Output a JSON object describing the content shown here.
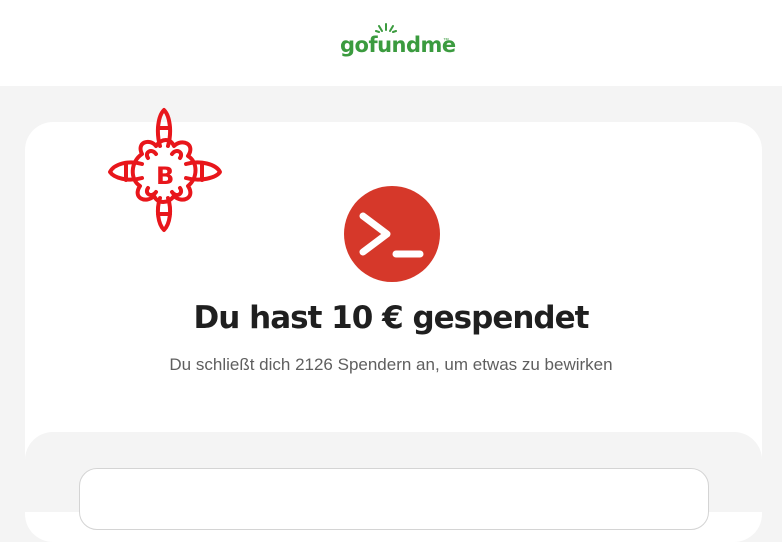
{
  "header": {
    "logo_text": "gofundme",
    "logo_mark": "™",
    "logo_color": "#3b9b3f"
  },
  "badge": {
    "icon": "bitcoin-b-scribble-icon",
    "letter": "B",
    "color": "#e8161b"
  },
  "confirmation": {
    "icon": "terminal-prompt-icon",
    "icon_color": "#d6382a",
    "headline": "Du hast 10 € gespendet",
    "subline": "Du schließt dich 2126 Spendern an, um etwas zu bewirken"
  }
}
